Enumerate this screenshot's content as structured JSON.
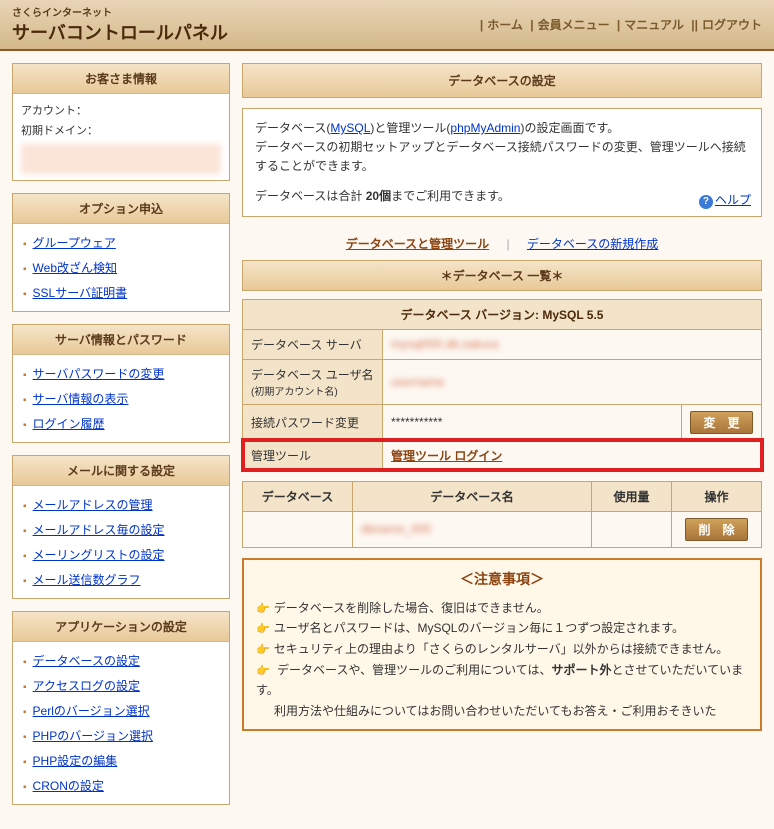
{
  "header": {
    "subtitle": "さくらインターネット",
    "title": "サーバコントロールパネル",
    "nav": {
      "home": "ホーム",
      "member": "会員メニュー",
      "manual": "マニュアル",
      "logout": "ログアウト"
    }
  },
  "sidebar": {
    "customer": {
      "head": "お客さま情報",
      "account_label": "アカウント：",
      "domain_label": "初期ドメイン："
    },
    "option": {
      "head": "オプション申込",
      "items": [
        "グループウェア",
        "Web改ざん検知",
        "SSLサーバ証明書"
      ]
    },
    "server": {
      "head": "サーバ情報とパスワード",
      "items": [
        "サーバパスワードの変更",
        "サーバ情報の表示",
        "ログイン履歴"
      ]
    },
    "mail": {
      "head": "メールに関する設定",
      "items": [
        "メールアドレスの管理",
        "メールアドレス毎の設定",
        "メーリングリストの設定",
        "メール送信数グラフ"
      ]
    },
    "app": {
      "head": "アプリケーションの設定",
      "items": [
        "データベースの設定",
        "アクセスログの設定",
        "Perlのバージョン選択",
        "PHPのバージョン選択",
        "PHP設定の編集",
        "CRONの設定"
      ]
    }
  },
  "main": {
    "title": "データベースの設定",
    "desc1_a": "データベース(",
    "desc1_link1": "MySQL",
    "desc1_b": ")と管理ツール(",
    "desc1_link2": "phpMyAdmin",
    "desc1_c": ")の設定画面です。",
    "desc2": "データベースの初期セットアップとデータベース接続パスワードの変更、管理ツールへ接続することができます。",
    "desc3_a": "データベースは合計 ",
    "desc3_count": "20個",
    "desc3_b": "までご利用できます。",
    "help": "ヘルプ",
    "tab_current": "データベースと管理ツール",
    "tab_new": "データベースの新規作成",
    "list_head": "＊データベース 一覧＊",
    "db_version_row": "データベース バージョン: MySQL 5.5",
    "rows": {
      "server": "データベース サーバ",
      "user": "データベース ユーザ名",
      "user_sub": "(初期アカウント名)",
      "pw": "接続パスワード変更",
      "pw_value": "***********",
      "pw_btn": "変　更",
      "tool": "管理ツール",
      "tool_link": "管理ツール ログイン"
    },
    "cols": {
      "db": "データベース",
      "name": "データベース名",
      "use": "使用量",
      "op": "操作"
    },
    "delete_btn": "削　除",
    "notice": {
      "title": "＜注意事項＞",
      "items": [
        "データベースを削除した場合、復旧はできません。",
        "ユーザ名とパスワードは、MySQLのバージョン毎に１つずつ設定されます。",
        "セキュリティ上の理由より「さくらのレンタルサーバ」以外からは接続できません。"
      ],
      "last_a": "データベースや、管理ツールのご利用については、",
      "last_b": "サポート外",
      "last_c": "とさせていただいています。",
      "trunc": "利用方法や仕組みについてはお問い合わせいただいてもお答え・ご利用おそきいた"
    }
  }
}
